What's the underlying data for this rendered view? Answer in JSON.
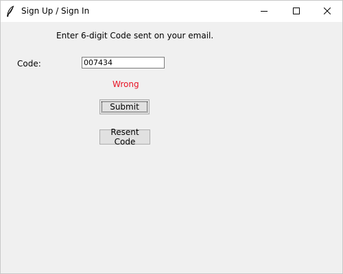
{
  "window": {
    "title": "Sign Up / Sign In",
    "icon": "feather-icon",
    "controls": [
      "minimize-icon",
      "maximize-icon",
      "close-icon"
    ]
  },
  "form": {
    "instruction": "Enter 6-digit Code sent on your email.",
    "code_label": "Code:",
    "code_value": "007434",
    "status_text": "Wrong",
    "status_color": "#e81123",
    "submit_label": "Submit",
    "resend_label": "Resent Code"
  }
}
